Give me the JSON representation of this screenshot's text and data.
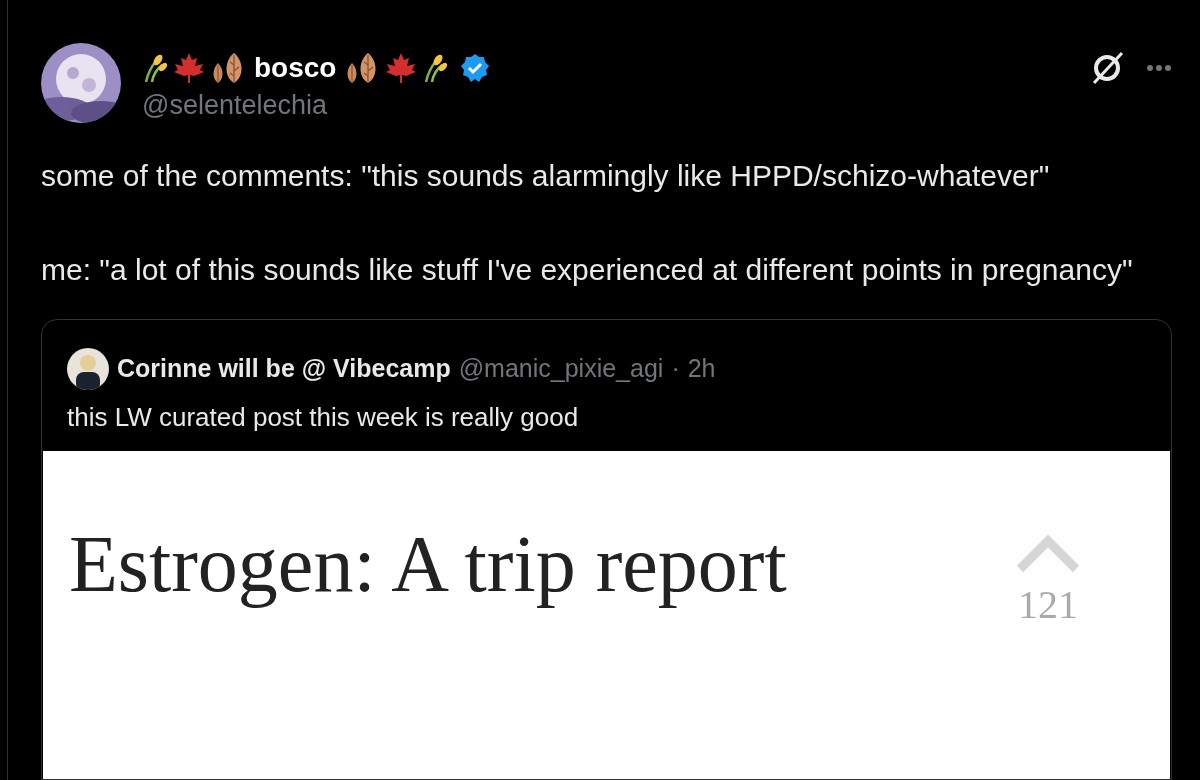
{
  "post": {
    "display_name": "bosco",
    "handle": "@selentelechia",
    "verified": true,
    "paragraphs": [
      "some of the comments: \"this sounds alarmingly like HPPD/schizo-whatever\"",
      "me: \"a lot of this sounds like stuff I've experienced at different points in pregnancy\""
    ]
  },
  "quoted_post": {
    "display_name": "Corinne will be @ Vibecamp",
    "handle": "@manic_pixie_agi",
    "separator": "·",
    "time": "2h",
    "text": "this LW curated post this week is really good",
    "preview": {
      "title": "Estrogen: A trip report",
      "vote_count": "121"
    }
  }
}
